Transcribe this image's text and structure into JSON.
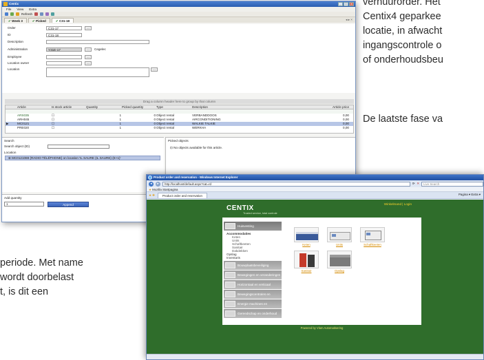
{
  "document": {
    "right_lines": [
      "verhuurorder. Het",
      "Centix4 geparkee",
      "locatie, in afwacht",
      "ingangscontrole o",
      "of onderhoudsbeu"
    ],
    "right_lines2": [
      "De laatste fase va"
    ],
    "left_lines": [
      "periode. Met name",
      "wordt doorbelast",
      "t, is dit een"
    ]
  },
  "centix_window": {
    "title": "Centix",
    "menu": [
      "File",
      "View",
      "Extra"
    ],
    "toolbar": {
      "refresh_label": "Refresh"
    },
    "tabs": [
      "Week 3",
      "Picked",
      "C31-18"
    ],
    "form": {
      "order_label": "Order",
      "order_value": "C31-17",
      "id_label": "ID",
      "id_value": "C31-18",
      "description_label": "Description",
      "administration_label": "Administration",
      "administration_value": "Y31E-17",
      "administration_extra": "Cegelec",
      "employee_label": "Employee",
      "location_owner_label": "Location owner",
      "location_label": "Location",
      "browse_button": "..."
    },
    "group_hint": "Drag a column header here to group by that column",
    "grid": {
      "headers": [
        "Article",
        "Is stock article",
        "Quantity",
        "Picked quantity",
        "Type",
        "Description",
        "Article price"
      ],
      "rows": [
        {
          "article": "",
          "stock": "",
          "qty": "",
          "picked": "",
          "type": "",
          "description": "",
          "price": ""
        },
        {
          "article": "ARS035",
          "stock": "☐",
          "qty": "1",
          "picked": "0",
          "type": "Object rental",
          "description": "VERBANDDOOS",
          "price": "0,00"
        },
        {
          "article": "ARH045",
          "stock": "☐",
          "qty": "1",
          "picked": "0",
          "type": "Object rental",
          "description": "AIRCONDITIONING",
          "price": "0,00"
        },
        {
          "article": "MC0121",
          "stock": "☐",
          "qty": "1",
          "picked": "0",
          "type": "Object rental",
          "description": "WALKIE TALKIE",
          "price": "0,00"
        },
        {
          "article": "PRE020",
          "stock": "☐",
          "qty": "1",
          "picked": "0",
          "type": "Object rental",
          "description": "WERKHA",
          "price": "0,00"
        }
      ]
    },
    "search": {
      "label": "Search",
      "object_label": "Search object (ID)",
      "location_label": "Location",
      "location_item": "MC0121088 (RADIO-TÉLÉPHONE) on location 'IL SAURE (IL SAURE) (E+1)'"
    },
    "picked_objects": {
      "label": "Picked objects",
      "empty_text": "No objects available for this article."
    },
    "add_quantity": {
      "label": "Add quantity",
      "value": "1",
      "append_button": "Append"
    }
  },
  "ie_window": {
    "title": "Product order and reservation - Windows Internet Explorer",
    "url": "http://localhost/default.aspx?cat=rd",
    "search_placeholder": "Live Search",
    "favorites_label": "Mozilla Startpagina",
    "tab_label": "Product order and reservation",
    "commands": "Pagina ▾  Extra ▾",
    "site": {
      "logo": "CENTIX",
      "tagline": "Trusted service, total controle",
      "top_links": "Winkelmand | Login",
      "nav": [
        {
          "label": "Huisvesting",
          "active": true
        },
        {
          "label": "Bouwplaatsbeveiliging",
          "active": false
        },
        {
          "label": "Bewegingen en veranderingen",
          "active": false
        },
        {
          "label": "Horizontaal en verticaal transport",
          "active": false
        },
        {
          "label": "Bewegingscentrales en energie",
          "active": false
        },
        {
          "label": "Energie machines en constructie-werken",
          "active": false
        },
        {
          "label": "Gereedschap en onderhoud",
          "active": false
        }
      ],
      "subnav": {
        "group": "Accommodaties",
        "items": [
          "Keten",
          "Units",
          "Schaftkeeten",
          "Sanitair",
          "Dakdekken"
        ],
        "extra": [
          "Opslag",
          "Inventaris"
        ]
      },
      "products": [
        "Keten",
        "Units",
        "Schaftkeeten",
        "Sanitair",
        "Opslag"
      ],
      "footer": "Powered by Vlam Automatisering"
    }
  }
}
